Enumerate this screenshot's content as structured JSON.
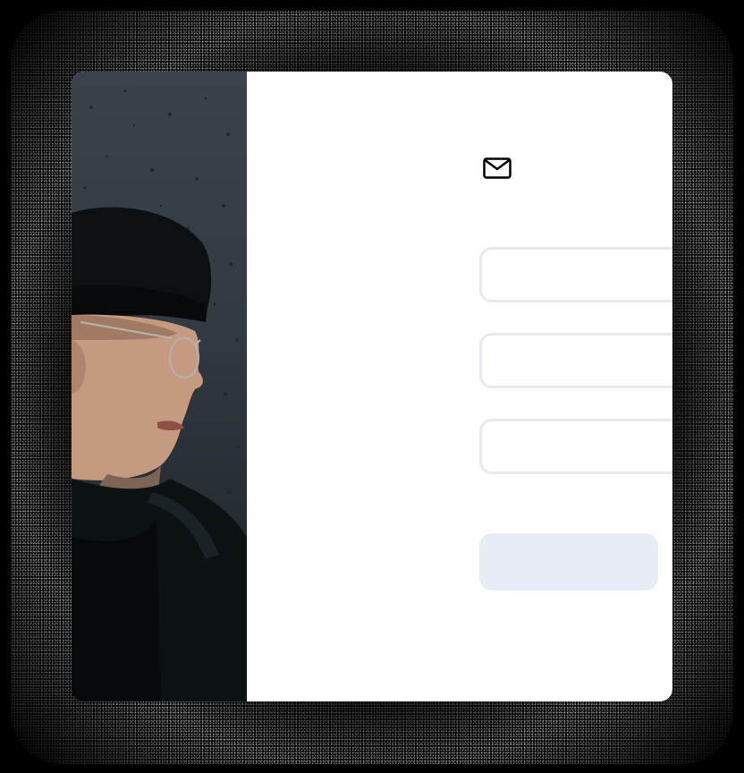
{
  "form": {
    "icon": "mail-icon",
    "fields": [
      {
        "value": "",
        "placeholder": ""
      },
      {
        "value": "",
        "placeholder": ""
      },
      {
        "value": "",
        "placeholder": ""
      }
    ],
    "submit_label": ""
  },
  "photo": {
    "subject": "person-portrait"
  },
  "colors": {
    "card_bg": "#ffffff",
    "field_border": "#e7eaf0",
    "button_bg": "#e8edf5",
    "page_bg": "#000000"
  }
}
